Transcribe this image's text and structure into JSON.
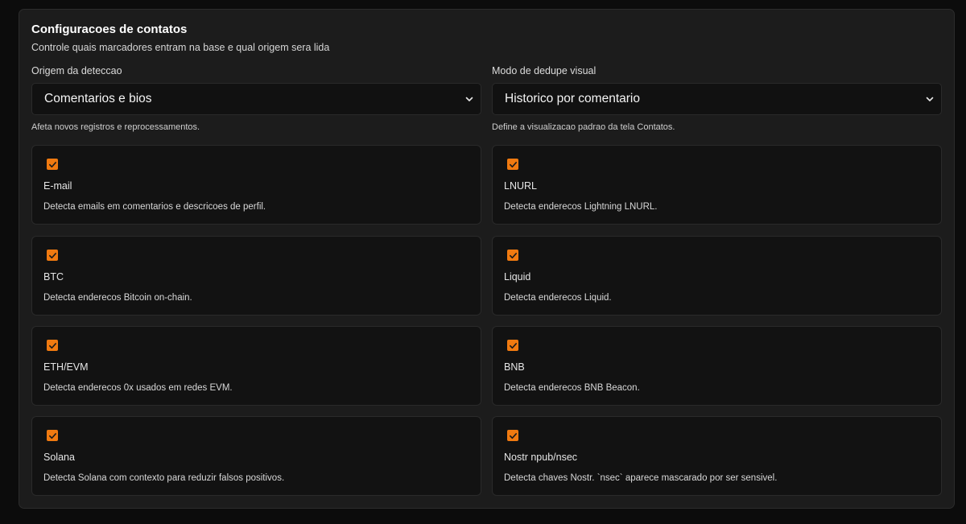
{
  "header": {
    "title": "Configuracoes de contatos",
    "subtitle": "Controle quais marcadores entram na base e qual origem sera lida"
  },
  "origin": {
    "label": "Origem da deteccao",
    "value": "Comentarios e bios",
    "help": "Afeta novos registros e reprocessamentos."
  },
  "dedupe": {
    "label": "Modo de dedupe visual",
    "value": "Historico por comentario",
    "help": "Define a visualizacao padrao da tela Contatos."
  },
  "markers": [
    {
      "name": "E-mail",
      "desc": "Detecta emails em comentarios e descricoes de perfil.",
      "checked": true
    },
    {
      "name": "LNURL",
      "desc": "Detecta enderecos Lightning LNURL.",
      "checked": true
    },
    {
      "name": "BTC",
      "desc": "Detecta enderecos Bitcoin on-chain.",
      "checked": true
    },
    {
      "name": "Liquid",
      "desc": "Detecta enderecos Liquid.",
      "checked": true
    },
    {
      "name": "ETH/EVM",
      "desc": "Detecta enderecos 0x usados em redes EVM.",
      "checked": true
    },
    {
      "name": "BNB",
      "desc": "Detecta enderecos BNB Beacon.",
      "checked": true
    },
    {
      "name": "Solana",
      "desc": "Detecta Solana com contexto para reduzir falsos positivos.",
      "checked": true
    },
    {
      "name": "Nostr npub/nsec",
      "desc": "Detecta chaves Nostr. `nsec` aparece mascarado por ser sensivel.",
      "checked": true
    }
  ],
  "colors": {
    "checkbox": "#f07a10",
    "panel": "#1c1c1c",
    "card": "#121212"
  },
  "icons": {
    "select_chevron": "chevron-down-icon",
    "checkbox_mark": "checkmark-icon"
  }
}
